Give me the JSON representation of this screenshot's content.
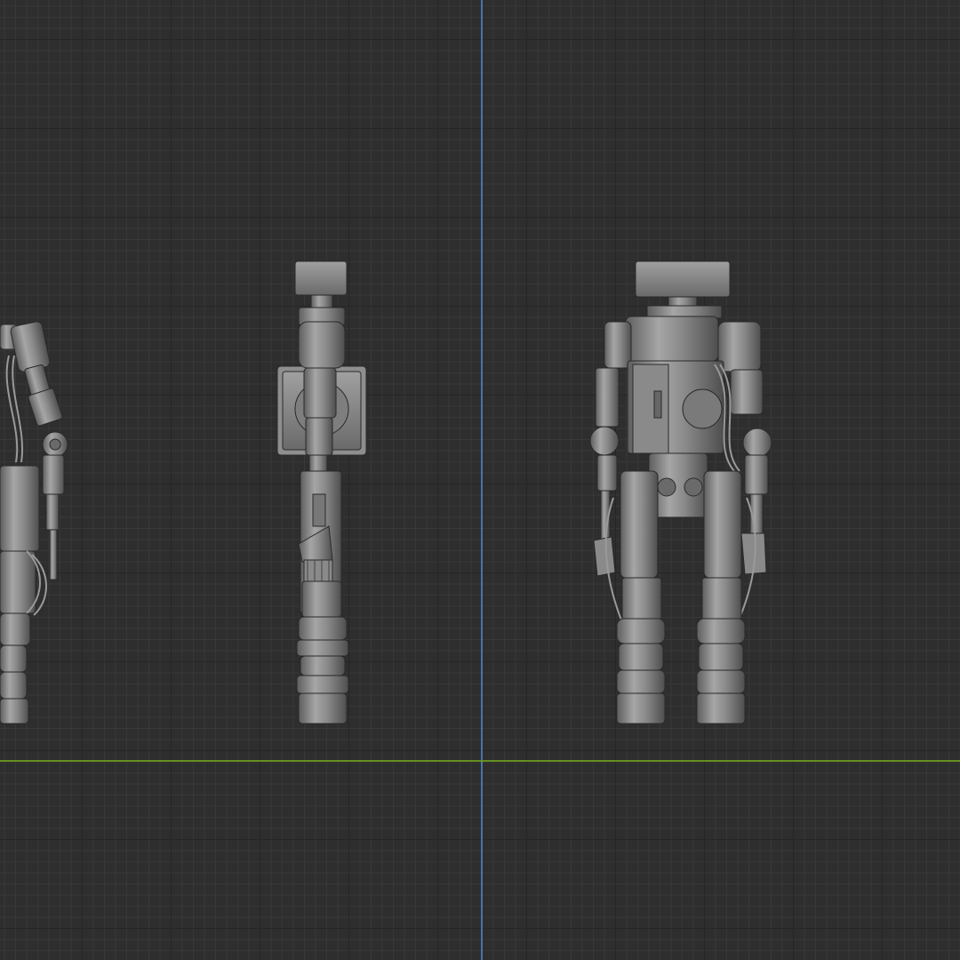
{
  "viewport": {
    "view": "orthographic-3d-viewport",
    "grid_visible": true,
    "axes": {
      "z_axis_color": "#4a7fbf",
      "y_axis_color": "#6b9a1f"
    },
    "background_color": "#2e2e2e"
  },
  "scene": {
    "objects": [
      {
        "name": "robot-side-view",
        "shading": "solid-gray"
      },
      {
        "name": "robot-profile-view",
        "shading": "solid-gray"
      },
      {
        "name": "robot-back-view",
        "shading": "solid-gray"
      }
    ],
    "material_color": "#8c8c8c"
  }
}
